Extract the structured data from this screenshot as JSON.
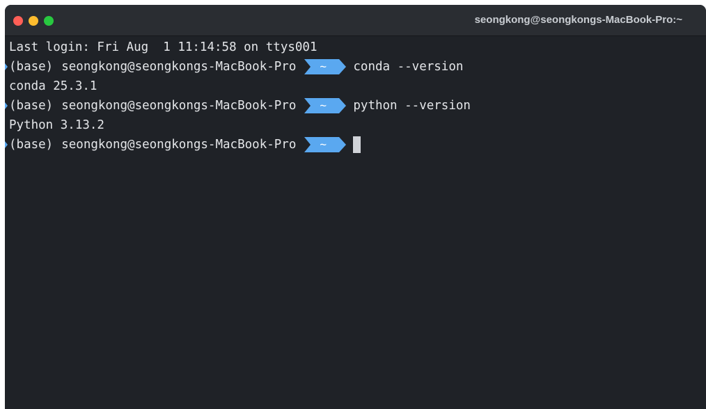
{
  "window": {
    "title": "seongkong@seongkongs-MacBook-Pro:~"
  },
  "terminal": {
    "login_line": "Last login: Fri Aug  1 11:14:58 on ttys001",
    "prompt": {
      "env": "(base)",
      "user_host": "seongkong@seongkongs-MacBook-Pro",
      "path": "~"
    },
    "commands": [
      {
        "command": "conda --version",
        "output": "conda 25.3.1"
      },
      {
        "command": "python --version",
        "output": "Python 3.13.2"
      }
    ]
  },
  "colors": {
    "background": "#1f2227",
    "titlebar": "#2a2d32",
    "prompt_segment": "#5aa8f0",
    "text": "#e4e6e9"
  },
  "icons": [
    "close-button",
    "minimize-button",
    "maximize-button",
    "prompt-arrow-icon",
    "cursor-block"
  ]
}
